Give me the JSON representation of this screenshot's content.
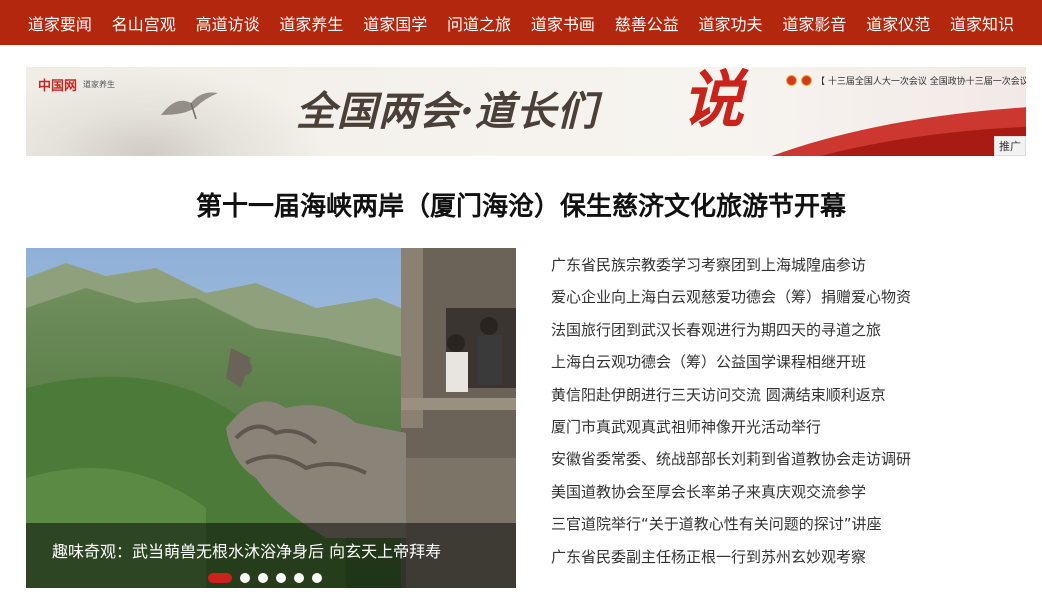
{
  "nav": {
    "items": [
      {
        "label": "道家要闻"
      },
      {
        "label": "名山宫观"
      },
      {
        "label": "高道访谈"
      },
      {
        "label": "道家养生"
      },
      {
        "label": "道家国学"
      },
      {
        "label": "问道之旅"
      },
      {
        "label": "道家书画"
      },
      {
        "label": "慈善公益"
      },
      {
        "label": "道家功夫"
      },
      {
        "label": "道家影音"
      },
      {
        "label": "道家仪范"
      },
      {
        "label": "道家知识"
      }
    ],
    "background_color": "#b3270e"
  },
  "banner": {
    "logo_mark": "中国网",
    "logo_site": "道家养生",
    "title": "全国两会·道长们",
    "title_emphasis": "说",
    "meeting_text": "【 十三届全国人大一次会议  全国政协十三届一次会议 】",
    "ad_label": "推广",
    "accent_color": "#c8241c"
  },
  "headline": {
    "text": "第十一届海峡两岸（厦门海沧）保生慈济文化旅游节开幕"
  },
  "slider": {
    "caption": "趣味奇观：武当萌兽无根水沐浴净身后 向玄天上帝拜寿",
    "slide_count": 6,
    "active_index": 0,
    "dot_active_color": "#c8241c"
  },
  "news": {
    "items": [
      {
        "text": "广东省民族宗教委学习考察团到上海城隍庙参访"
      },
      {
        "text": "爱心企业向上海白云观慈爱功德会（筹）捐赠爱心物资"
      },
      {
        "text": "法国旅行团到武汉长春观进行为期四天的寻道之旅"
      },
      {
        "text": "上海白云观功德会（筹）公益国学课程相继开班"
      },
      {
        "text": "黄信阳赴伊朗进行三天访问交流 圆满结束顺利返京"
      },
      {
        "text": "厦门市真武观真武祖师神像开光活动举行"
      },
      {
        "text": "安徽省委常委、统战部部长刘莉到省道教协会走访调研"
      },
      {
        "text": "美国道教协会至厚会长率弟子来真庆观交流参学"
      },
      {
        "text": "三官道院举行“关于道教心性有关问题的探讨”讲座"
      },
      {
        "text": "广东省民委副主任杨正根一行到苏州玄妙观考察"
      }
    ]
  }
}
